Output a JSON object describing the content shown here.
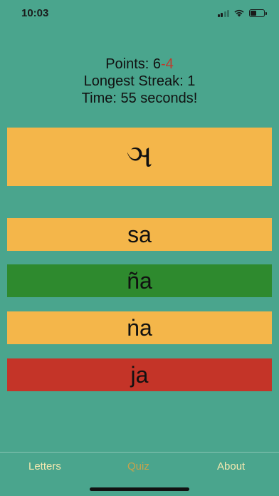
{
  "status_bar": {
    "time": "10:03",
    "battery_level": 0.45
  },
  "stats": {
    "points_label": "Points: ",
    "points_pos": "6",
    "points_neg": "-4",
    "streak_text": "Longest Streak: 1",
    "time_text": "Time: 55 seconds!"
  },
  "question": {
    "letter": "ઞ"
  },
  "answers": [
    {
      "label": "sa",
      "color": "#f4b64a"
    },
    {
      "label": "ña",
      "color": "#2e8a2e"
    },
    {
      "label": "ṅa",
      "color": "#f4b64a"
    },
    {
      "label": "ja",
      "color": "#c43428"
    }
  ],
  "tabs": [
    {
      "label": "Letters",
      "color": "#f6e9b0",
      "active": false
    },
    {
      "label": "Quiz",
      "color": "#c9a24a",
      "active": true
    },
    {
      "label": "About",
      "color": "#f6e9b0",
      "active": false
    }
  ],
  "colors": {
    "background": "#4aa58d",
    "card": "#f4b64a",
    "correct": "#2e8a2e",
    "wrong": "#c43428",
    "negative_text": "#c0392b"
  }
}
